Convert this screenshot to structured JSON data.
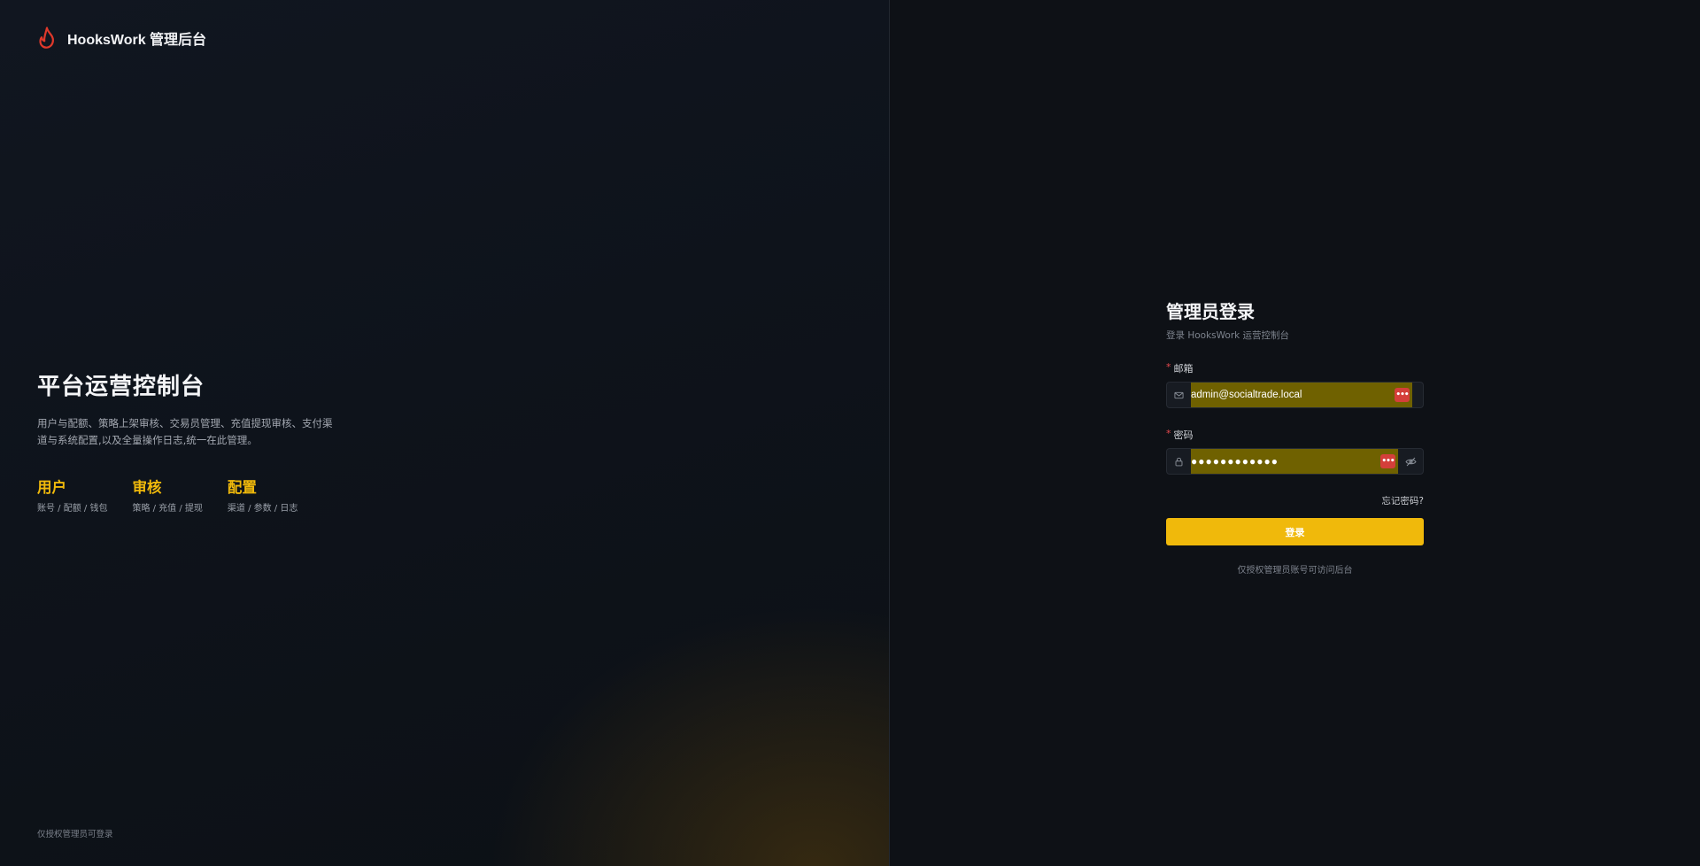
{
  "brand": {
    "name": "HooksWork 管理后台",
    "accent_color": "#e0392b",
    "icon": "flame-icon"
  },
  "hero": {
    "title": "平台运营控制台",
    "description": "用户与配额、策略上架审核、交易员管理、充值提现审核、支付渠道与系统配置,以及全量操作日志,统一在此管理。",
    "features": [
      {
        "title": "用户",
        "subtitle": "账号 / 配额 / 钱包"
      },
      {
        "title": "审核",
        "subtitle": "策略 / 充值 / 提现"
      },
      {
        "title": "配置",
        "subtitle": "渠道 / 参数 / 日志"
      }
    ],
    "footer": "仅授权管理员可登录",
    "accent_color": "#f0b90b"
  },
  "login": {
    "title": "管理员登录",
    "subtitle": "登录 HooksWork 运营控制台",
    "email": {
      "label": "邮箱",
      "required_mark": "*",
      "value": "admin@socialtrade.local",
      "icon": "mail-icon"
    },
    "password": {
      "label": "密码",
      "required_mark": "*",
      "value": "●●●●●●●●●●●●",
      "icon": "lock-icon",
      "toggle_icon": "eye-off-icon"
    },
    "password_manager_badge": "•••",
    "forgot_link": "忘记密码?",
    "submit_label": "登录",
    "footnote": "仅授权管理员账号可访问后台",
    "button_color": "#f0b90b",
    "autofill_color": "#6f6100"
  }
}
